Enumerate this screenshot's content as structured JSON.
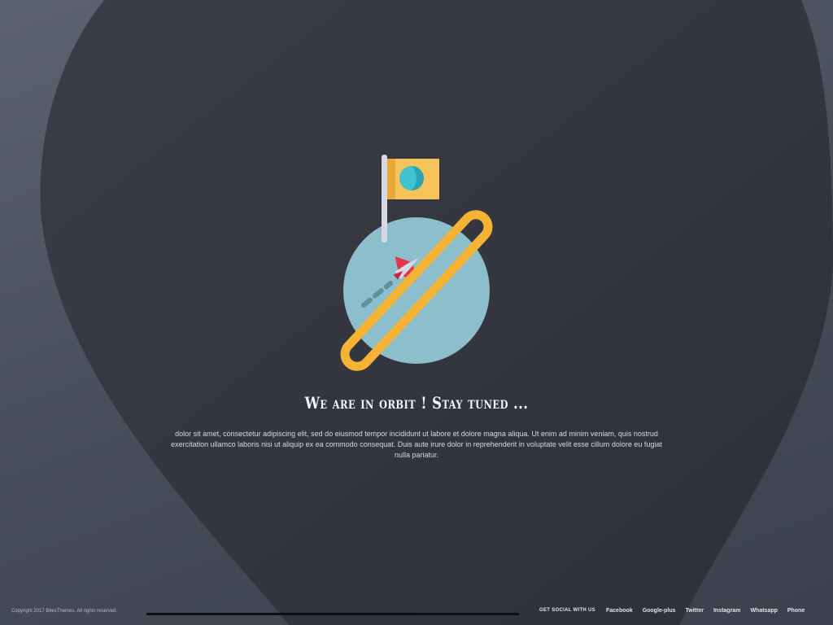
{
  "hero": {
    "title": "We are in orbit ! Stay tuned ...",
    "description": "dolor sit amet, consectetur adipiscing elit, sed do eiusmod tempor incididunt ut labore et dolore magna aliqua. Ut enim ad minim veniam, quis nostrud exercitation ullamco laboris nisi ut aliquip ex ea commodo consequat. Duis aute irure dolor in reprehenderit in voluptate velit esse cillum dolore eu fugiat nulla pariatur."
  },
  "illustration": {
    "icon": "planet-flag-rocket-icon",
    "colors": {
      "planet": "#8dbecb",
      "planet_shade": "#76a9b7",
      "ring": "#f5b335",
      "flag": "#f5c35a",
      "flag_dot": "#3fc4cf",
      "pole": "#d6d8e3",
      "rocket": "#e4354d"
    }
  },
  "footer": {
    "copyright": "Copyright 2017 BitesThemes. All rights reserved.",
    "social_label": "GET SOCIAL WITH US",
    "links": [
      "Facebook",
      "Google-plus",
      "Twitter",
      "Instagram",
      "Whatsapp",
      "Phone"
    ]
  },
  "theme": {
    "background": "#4a4f5c",
    "blob": "#32353e",
    "text": "#f3f3f5"
  }
}
